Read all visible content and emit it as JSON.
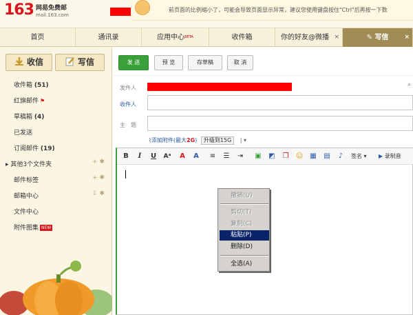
{
  "brand": {
    "number": "163",
    "name_cn": "网易免费邮",
    "domain": "mail.163.com"
  },
  "notice": {
    "text": "前页面的比例缩小了，可能会导致页面显示异常，建议您使用键盘按住\"Ctrl\"后再按一下数"
  },
  "nav": {
    "tabs": [
      {
        "label": "首页"
      },
      {
        "label": "通讯录"
      },
      {
        "label": "应用中心",
        "badge": "BETA"
      },
      {
        "label": "收件箱"
      },
      {
        "label": "你的好友@微播",
        "close": "×"
      },
      {
        "label": "写信",
        "close": "×"
      }
    ]
  },
  "sidebar": {
    "receive_label": "收信",
    "compose_label": "写信",
    "items": [
      {
        "label": "收件箱",
        "count": "(51)"
      },
      {
        "label": "红旗邮件",
        "flag": "⚑"
      },
      {
        "label": "草稿箱",
        "count": "(4)"
      },
      {
        "label": "已发送"
      },
      {
        "label": "订阅邮件",
        "count": "(19)"
      },
      {
        "label": "其他3个文件夹"
      },
      {
        "label": "邮件标签"
      },
      {
        "label": "邮箱中心"
      },
      {
        "label": "文件中心"
      },
      {
        "label": "附件图集",
        "badge": "NEW"
      }
    ]
  },
  "toolbar": {
    "send_label": "发 送",
    "preview_label": "预 览",
    "draft_label": "存草稿",
    "cancel_label": "取 消"
  },
  "form": {
    "from_label": "发件人",
    "to_label": "收件人",
    "subject_label": "主　题",
    "attach_label": "添加附件(最大",
    "attach_size": "2G",
    "attach_close": ")",
    "upgrade_label": "升级到15G"
  },
  "editor": {
    "signature_label": "签名",
    "record_label": "录制音"
  },
  "context_menu": {
    "items": [
      {
        "label": "撤销(U)",
        "enabled": false
      },
      {
        "label": "剪切(T)",
        "enabled": false
      },
      {
        "label": "复制(C)",
        "enabled": false
      },
      {
        "label": "粘贴(P)",
        "enabled": true,
        "highlighted": true
      },
      {
        "label": "删除(D)",
        "enabled": true
      },
      {
        "label": "全选(A)",
        "enabled": true
      }
    ]
  },
  "colors": {
    "brand_red": "#d8151c",
    "send_green": "#3aa13a",
    "highlight": "#0a246a",
    "redaction": "#ff0000"
  }
}
